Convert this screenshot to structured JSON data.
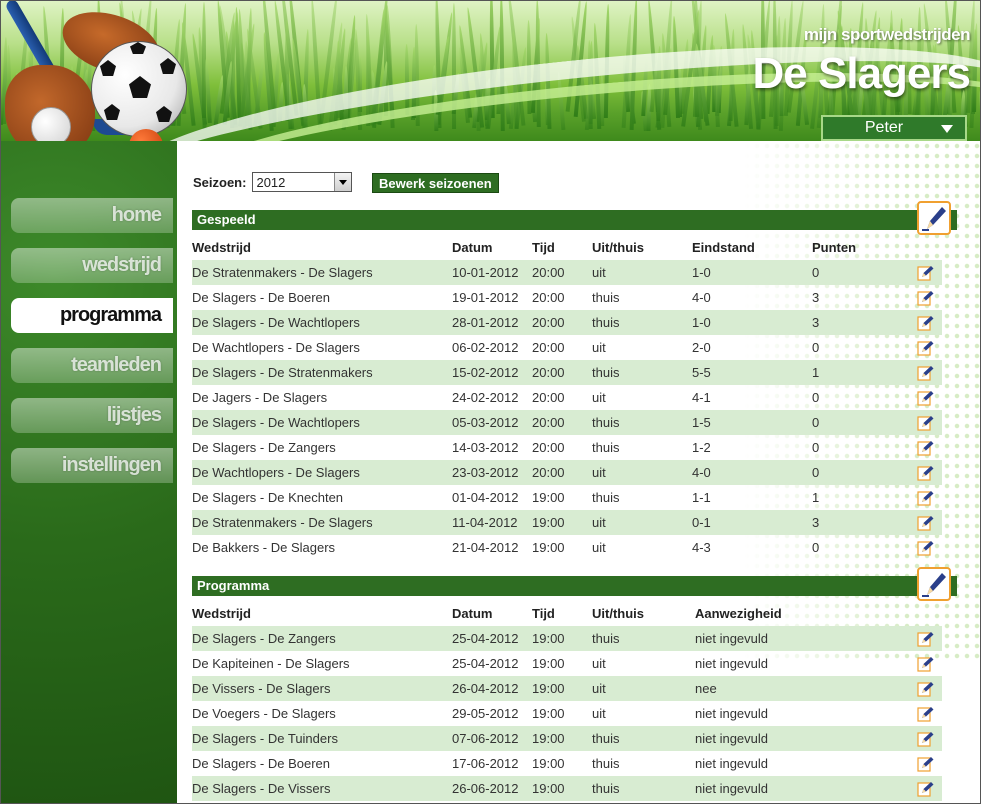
{
  "brand": {
    "subtitle": "mijn sportwedstrijden",
    "title": "De Slagers"
  },
  "user": {
    "name": "Peter",
    "icon": "chevron-down-icon"
  },
  "nav": {
    "items": [
      {
        "label": "home",
        "active": false
      },
      {
        "label": "wedstrijd",
        "active": false
      },
      {
        "label": "programma",
        "active": true
      },
      {
        "label": "teamleden",
        "active": false
      },
      {
        "label": "lijstjes",
        "active": false
      },
      {
        "label": "instellingen",
        "active": false
      }
    ]
  },
  "season": {
    "label": "Seizoen:",
    "value": "2012",
    "edit_button": "Bewerk seizoenen"
  },
  "played": {
    "title": "Gespeeld",
    "columns": [
      "Wedstrijd",
      "Datum",
      "Tijd",
      "Uit/thuis",
      "Eindstand",
      "Punten"
    ],
    "rows": [
      [
        "De Stratenmakers - De Slagers",
        "10-01-2012",
        "20:00",
        "uit",
        "1-0",
        "0"
      ],
      [
        "De Slagers - De Boeren",
        "19-01-2012",
        "20:00",
        "thuis",
        "4-0",
        "3"
      ],
      [
        "De Slagers - De Wachtlopers",
        "28-01-2012",
        "20:00",
        "thuis",
        "1-0",
        "3"
      ],
      [
        "De Wachtlopers - De Slagers",
        "06-02-2012",
        "20:00",
        "uit",
        "2-0",
        "0"
      ],
      [
        "De Slagers - De Stratenmakers",
        "15-02-2012",
        "20:00",
        "thuis",
        "5-5",
        "1"
      ],
      [
        "De Jagers - De Slagers",
        "24-02-2012",
        "20:00",
        "uit",
        "4-1",
        "0"
      ],
      [
        "De Slagers - De Wachtlopers",
        "05-03-2012",
        "20:00",
        "thuis",
        "1-5",
        "0"
      ],
      [
        "De Slagers - De Zangers",
        "14-03-2012",
        "20:00",
        "thuis",
        "1-2",
        "0"
      ],
      [
        "De Wachtlopers - De Slagers",
        "23-03-2012",
        "20:00",
        "uit",
        "4-0",
        "0"
      ],
      [
        "De Slagers - De Knechten",
        "01-04-2012",
        "19:00",
        "thuis",
        "1-1",
        "1"
      ],
      [
        "De Stratenmakers - De Slagers",
        "11-04-2012",
        "19:00",
        "uit",
        "0-1",
        "3"
      ],
      [
        "De Bakkers - De Slagers",
        "21-04-2012",
        "19:00",
        "uit",
        "4-3",
        "0"
      ]
    ]
  },
  "program": {
    "title": "Programma",
    "columns": [
      "Wedstrijd",
      "Datum",
      "Tijd",
      "Uit/thuis",
      "Aanwezigheid"
    ],
    "rows": [
      [
        "De Slagers - De Zangers",
        "25-04-2012",
        "19:00",
        "thuis",
        "niet ingevuld"
      ],
      [
        "De Kapiteinen - De Slagers",
        "25-04-2012",
        "19:00",
        "uit",
        "niet ingevuld"
      ],
      [
        "De Vissers - De Slagers",
        "26-04-2012",
        "19:00",
        "uit",
        "nee"
      ],
      [
        "De Voegers - De Slagers",
        "29-05-2012",
        "19:00",
        "uit",
        "niet ingevuld"
      ],
      [
        "De Slagers - De Tuinders",
        "07-06-2012",
        "19:00",
        "thuis",
        "niet ingevuld"
      ],
      [
        "De Slagers - De Boeren",
        "17-06-2012",
        "19:00",
        "thuis",
        "niet ingevuld"
      ],
      [
        "De Slagers - De Vissers",
        "26-06-2012",
        "19:00",
        "thuis",
        "niet ingevuld"
      ]
    ]
  },
  "icons": {
    "edit": "edit-pencil-icon",
    "edit_large": "edit-section-icon"
  },
  "colors": {
    "accent": "#2e6d22",
    "row_alt": "#d8ecd2",
    "icon_border": "#f0a030"
  }
}
